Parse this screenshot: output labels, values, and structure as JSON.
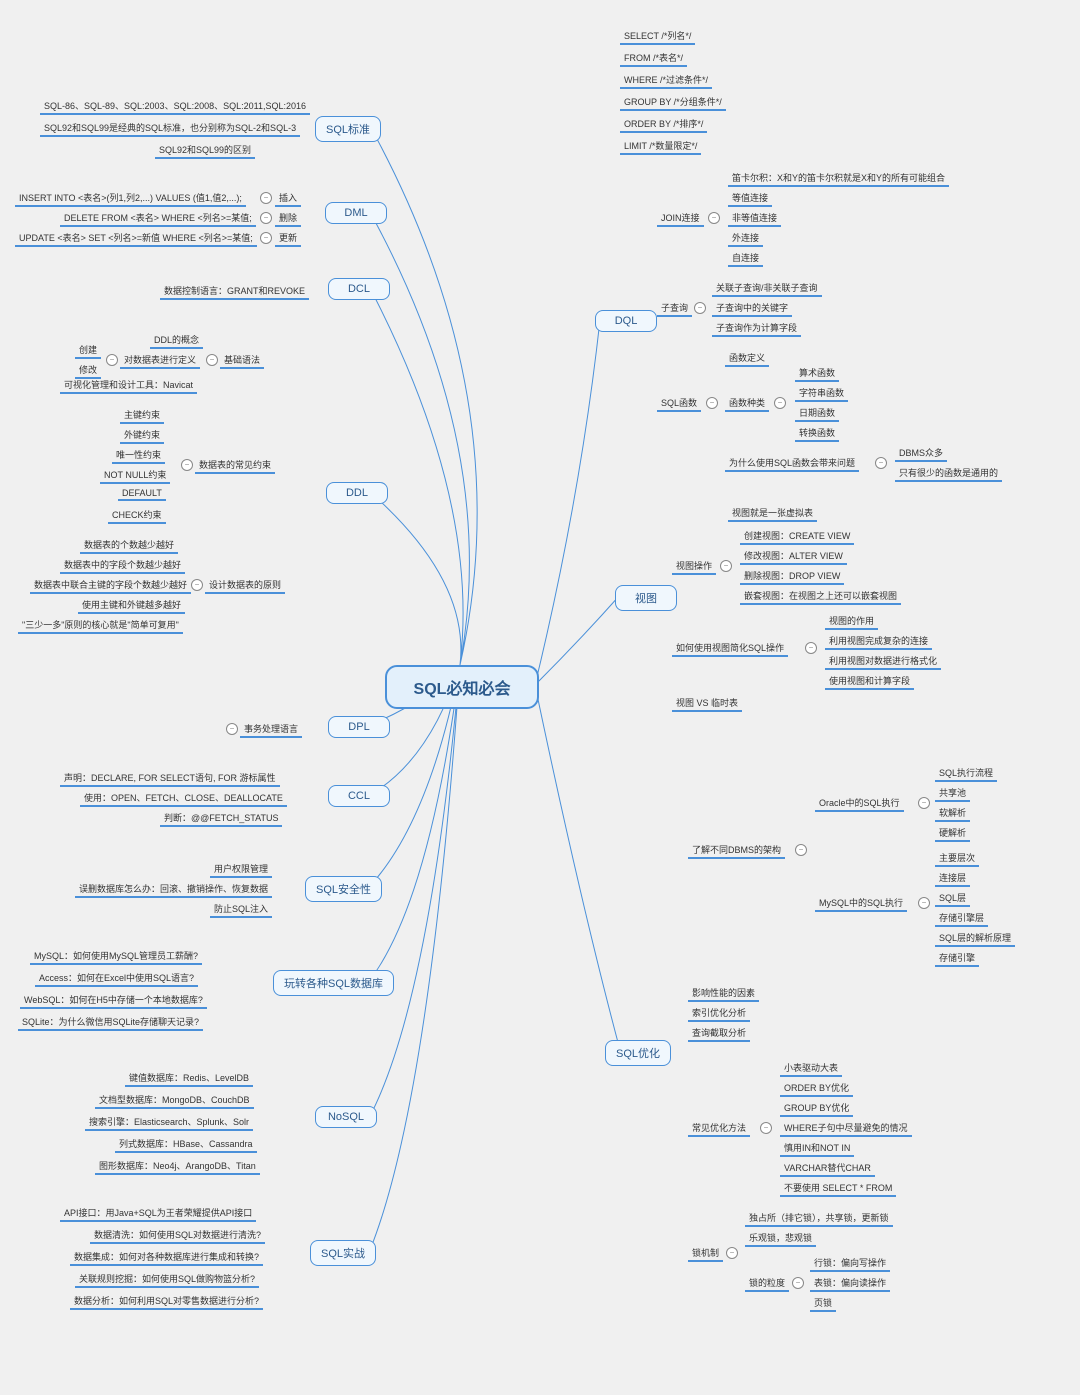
{
  "center": "SQL必知必会",
  "branches": {
    "sql_std": "SQL标准",
    "dml": "DML",
    "dcl": "DCL",
    "ddl": "DDL",
    "dpl": "DPL",
    "ccl": "CCL",
    "sec": "SQL安全性",
    "dbs": "玩转各种SQL数据库",
    "nosql": "NoSQL",
    "practice": "SQL实战",
    "dql": "DQL",
    "view": "视图",
    "opt": "SQL优化"
  },
  "sub": {
    "ddl_basic": "基础语法",
    "ddl_constraint": "数据表的常见约束",
    "ddl_design": "设计数据表的原则",
    "dql_join": "JOIN连接",
    "dql_sub": "子查询",
    "dql_func": "SQL函数",
    "view_op": "视图操作",
    "view_simplify": "如何使用视图简化SQL操作",
    "opt_arch": "了解不同DBMS的架构",
    "opt_common": "常见优化方法",
    "opt_lock": "锁机制",
    "opt_gran": "锁的粒度",
    "opt_oracle": "Oracle中的SQL执行",
    "opt_mysql": "MySQL中的SQL执行",
    "func_kind": "函数种类",
    "func_issue": "为什么使用SQL函数会带来问题"
  },
  "leaves": {
    "std1": "SQL-86、SQL-89、SQL:2003、SQL:2008、SQL:2011,SQL:2016",
    "std2": "SQL92和SQL99是经典的SQL标准，也分别称为SQL-2和SQL-3",
    "std3": "SQL92和SQL99的区别",
    "dml1": "INSERT INTO <表名>(列1,列2,...) VALUES (值1,值2,...);",
    "dml1b": "插入",
    "dml2": "DELETE FROM <表名> WHERE <列名>=某值;",
    "dml2b": "删除",
    "dml3": "UPDATE <表名> SET <列名>=新值 WHERE <列名>=某值;",
    "dml3b": "更新",
    "dcl1": "数据控制语言：GRANT和REVOKE",
    "ddl_b1": "DDL的概念",
    "ddl_b2": "对数据表进行定义",
    "ddl_b2a": "创建",
    "ddl_b2b": "修改",
    "ddl_b3": "可视化管理和设计工具：Navicat",
    "ddl_c1": "主键约束",
    "ddl_c2": "外键约束",
    "ddl_c3": "唯一性约束",
    "ddl_c4": "NOT NULL约束",
    "ddl_c5": "DEFAULT",
    "ddl_c6": "CHECK约束",
    "ddl_d1": "数据表的个数越少越好",
    "ddl_d2": "数据表中的字段个数越少越好",
    "ddl_d3": "数据表中联合主键的字段个数越少越好",
    "ddl_d4": "使用主键和外键越多越好",
    "ddl_d5": "\"三少一多\"原则的核心就是\"简单可复用\"",
    "dpl1": "事务处理语言",
    "ccl1": "声明：DECLARE, FOR SELECT语句, FOR 游标属性",
    "ccl2": "使用：OPEN、FETCH、CLOSE、DEALLOCATE",
    "ccl3": "判断：@@FETCH_STATUS",
    "sec1": "用户权限管理",
    "sec2": "误删数据库怎么办：回滚、撤销操作、恢复数据",
    "sec3": "防止SQL注入",
    "db1": "MySQL：如何使用MySQL管理员工薪酬?",
    "db2": "Access：如何在Excel中使用SQL语言?",
    "db3": "WebSQL：如何在H5中存储一个本地数据库?",
    "db4": "SQLite：为什么微信用SQLite存储聊天记录?",
    "no1": "键值数据库：Redis、LevelDB",
    "no2": "文档型数据库：MongoDB、CouchDB",
    "no3": "搜索引擎：Elasticsearch、Splunk、Solr",
    "no4": "列式数据库：HBase、Cassandra",
    "no5": "图形数据库：Neo4j、ArangoDB、Titan",
    "pr1": "API接口：用Java+SQL为王者荣耀提供API接口",
    "pr2": "数据清洗：如何使用SQL对数据进行清洗?",
    "pr3": "数据集成：如何对各种数据库进行集成和转换?",
    "pr4": "关联规则挖掘：如何使用SQL做购物篮分析?",
    "pr5": "数据分析：如何利用SQL对零售数据进行分析?",
    "dq1": "SELECT /*列名*/",
    "dq2": "FROM /*表名*/",
    "dq3": "WHERE /*过滤条件*/",
    "dq4": "GROUP BY /*分组条件*/",
    "dq5": "ORDER BY /*排序*/",
    "dq6": "LIMIT /*数量限定*/",
    "jo1": "笛卡尔积：X和Y的笛卡尔积就是X和Y的所有可能组合",
    "jo2": "等值连接",
    "jo3": "非等值连接",
    "jo4": "外连接",
    "jo5": "自连接",
    "sub1": "关联子查询/非关联子查询",
    "sub2": "子查询中的关键字",
    "sub3": "子查询作为计算字段",
    "fn1": "函数定义",
    "fn_k1": "算术函数",
    "fn_k2": "字符串函数",
    "fn_k3": "日期函数",
    "fn_k4": "转换函数",
    "fn_i1": "DBMS众多",
    "fn_i2": "只有很少的函数是通用的",
    "vw1": "视图就是一张虚拟表",
    "vw_o1": "创建视图：CREATE VIEW",
    "vw_o2": "修改视图：ALTER VIEW",
    "vw_o3": "删除视图：DROP VIEW",
    "vw_o4": "嵌套视图：在视图之上还可以嵌套视图",
    "vw_s1": "视图的作用",
    "vw_s2": "利用视图完成复杂的连接",
    "vw_s3": "利用视图对数据进行格式化",
    "vw_s4": "使用视图和计算字段",
    "vw3": "视图 VS 临时表",
    "ora1": "SQL执行流程",
    "ora2": "共享池",
    "ora3": "软解析",
    "ora4": "硬解析",
    "my1": "主要层次",
    "my2": "连接层",
    "my3": "SQL层",
    "my4": "存储引擎层",
    "my5": "SQL层的解析原理",
    "my6": "存储引擎",
    "opt1": "影响性能的因素",
    "opt2": "索引优化分析",
    "opt3": "查询截取分析",
    "cm1": "小表驱动大表",
    "cm2": "ORDER BY优化",
    "cm3": "GROUP BY优化",
    "cm4": "WHERE子句中尽量避免的情况",
    "cm5": "慎用IN和NOT IN",
    "cm6": "VARCHAR替代CHAR",
    "cm7": "不要使用 SELECT * FROM",
    "lk1": "独占所（排它锁），共享锁，更新锁",
    "lk2": "乐观锁，悲观锁",
    "gr1": "行锁：偏向写操作",
    "gr2": "表锁：偏向读操作",
    "gr3": "页锁"
  }
}
